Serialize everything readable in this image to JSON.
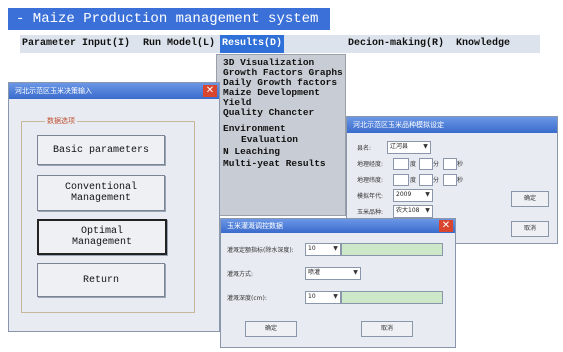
{
  "app": {
    "title": "- Maize Production management system"
  },
  "menu": [
    "Parameter Input(I)",
    "Run Model(L)",
    "Results(D)",
    "Decion-making(R)",
    "Knowledge"
  ],
  "results_menu": [
    "3D Visualization",
    "Growth Factors Graphs",
    "Daily Growth factors",
    "Maize Development",
    "Yield",
    "Quality Chancter",
    "Environment",
    "Evaluation",
    "N Leaching",
    "Multi-yeat Results"
  ],
  "param_window": {
    "title": "河北示范区玉米决策输入",
    "group_label": "数据选项",
    "close_glyph": "✕",
    "buttons": [
      "Basic parameters",
      "Conventional\nManagement",
      "Optimal\nManagement",
      "Return"
    ]
  },
  "site_window": {
    "title": "河北示范区玉米品种模拟设定",
    "labels": [
      "县名:",
      "地理经度:",
      "地理纬度:",
      "模拟年代:",
      "玉米品种:"
    ],
    "county_value": "辽河县",
    "deg": "度",
    "min": "分",
    "sec": "秒",
    "year_value": "2009",
    "variety_value": "农大108",
    "ok_label": "确定",
    "cancel_label": "取消"
  },
  "irrigation_window": {
    "title": "玉米灌溉调控数据",
    "labels": [
      "灌溉定额指标(除水深度):",
      "灌溉方式:",
      "灌溉深度(cm):"
    ],
    "value1": "10",
    "mode_value": "喷灌",
    "value3": "10",
    "close_glyph": "✕",
    "ok_label": "确定",
    "cancel_label": "取消"
  }
}
